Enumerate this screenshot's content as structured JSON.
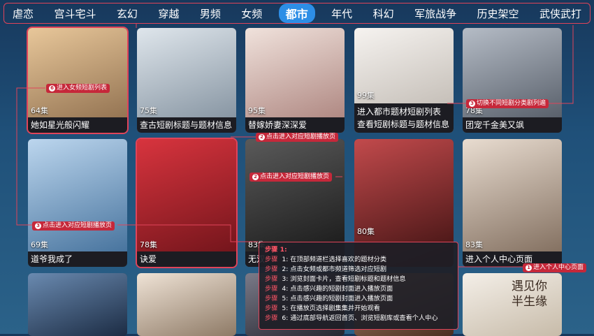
{
  "nav": {
    "tabs": [
      {
        "label": "虐恋"
      },
      {
        "label": "宫斗宅斗"
      },
      {
        "label": "玄幻"
      },
      {
        "label": "穿越"
      },
      {
        "label": "男频"
      },
      {
        "label": "女频"
      },
      {
        "label": "都市",
        "active": true
      },
      {
        "label": "年代"
      },
      {
        "label": "科幻"
      },
      {
        "label": "军旅战争"
      },
      {
        "label": "历史架空"
      },
      {
        "label": "武侠武打"
      }
    ]
  },
  "cards": [
    {
      "episodes": "64集",
      "title": "她如星光般闪耀",
      "poster_color": "#c9a27a"
    },
    {
      "episodes": "75集",
      "title": "查古短剧标题与题材信息",
      "poster_color": "#b8c4cf"
    },
    {
      "episodes": "95集",
      "title": "替嫁娇妻深深爱",
      "poster_color": "#d7c2bf"
    },
    {
      "episodes": "99集",
      "title": "进入都市题材短剧列表",
      "subtitle": "查看短剧标题与题材信息",
      "poster_color": "#e6e3e0"
    },
    {
      "episodes": "78集",
      "title": "团宠千金美又飒",
      "poster_color": "#8a8f99"
    },
    {
      "episodes": "69集",
      "title": "道爷我成了",
      "poster_color": "#8fb4d6"
    },
    {
      "episodes": "78集",
      "title": "诀爱",
      "poster_color": "#b22530"
    },
    {
      "episodes": "83集",
      "title": "无双",
      "poster_color": "#3a3a3a"
    },
    {
      "episodes": "80集",
      "title": "",
      "poster_color": "#9a3a3c"
    },
    {
      "episodes": "83集",
      "title": "进入个人中心页面",
      "poster_color": "#c9b7a8"
    },
    {
      "title": "",
      "poster_color": "#2e4a6a"
    },
    {
      "title": "",
      "poster_color": "#c8b8a8"
    },
    {
      "title": "",
      "poster_color": "#4a4a55"
    },
    {
      "title": "",
      "poster_color": "#7a5a4a"
    },
    {
      "title": "遇见你半生缘",
      "poster_color": "#d9d0c4"
    }
  ],
  "annotations": {
    "a1": {
      "num": "6",
      "text": "进入女频短剧列表"
    },
    "a2": {
      "num": "3",
      "text": "切换不同短剧分类剧列遍"
    },
    "a3": {
      "num": "2",
      "text": "点击进入对应短剧播放页"
    },
    "a4": {
      "num": "2",
      "text": "点击进入对应短剧播放页"
    },
    "a5": {
      "num": "3",
      "text": "点击进入对应短剧播放页"
    },
    "a6": {
      "num": "1",
      "text": "进入个人中心页面"
    }
  },
  "steps": {
    "header": "步骤 1:",
    "items": [
      {
        "label": "步骤",
        "text": "1:  在顶部频道栏选择喜欢的题材分类"
      },
      {
        "label": "步骤",
        "text": "2:  点击女频或都市频道筛选对应短剧"
      },
      {
        "label": "步骤",
        "text": "3:  浏览封面卡片，查看短剧标题和题材信息"
      },
      {
        "label": "步骤",
        "text": "4:  点击感兴趣的短剧封面进入播放页面"
      },
      {
        "label": "步骤",
        "text": "5:  点击感兴趣的短剧封面进入播放页面"
      },
      {
        "label": "步骤",
        "text": "5:  在播放页选择剧集集并开始观看"
      },
      {
        "label": "步骤",
        "text": "6:  通过底部导航返回首页、浏览短剧库或查看个人中心"
      }
    ]
  },
  "colors": {
    "accent": "#e0445a",
    "active_tab": "#2d8ee6",
    "background": "#1f5079"
  }
}
